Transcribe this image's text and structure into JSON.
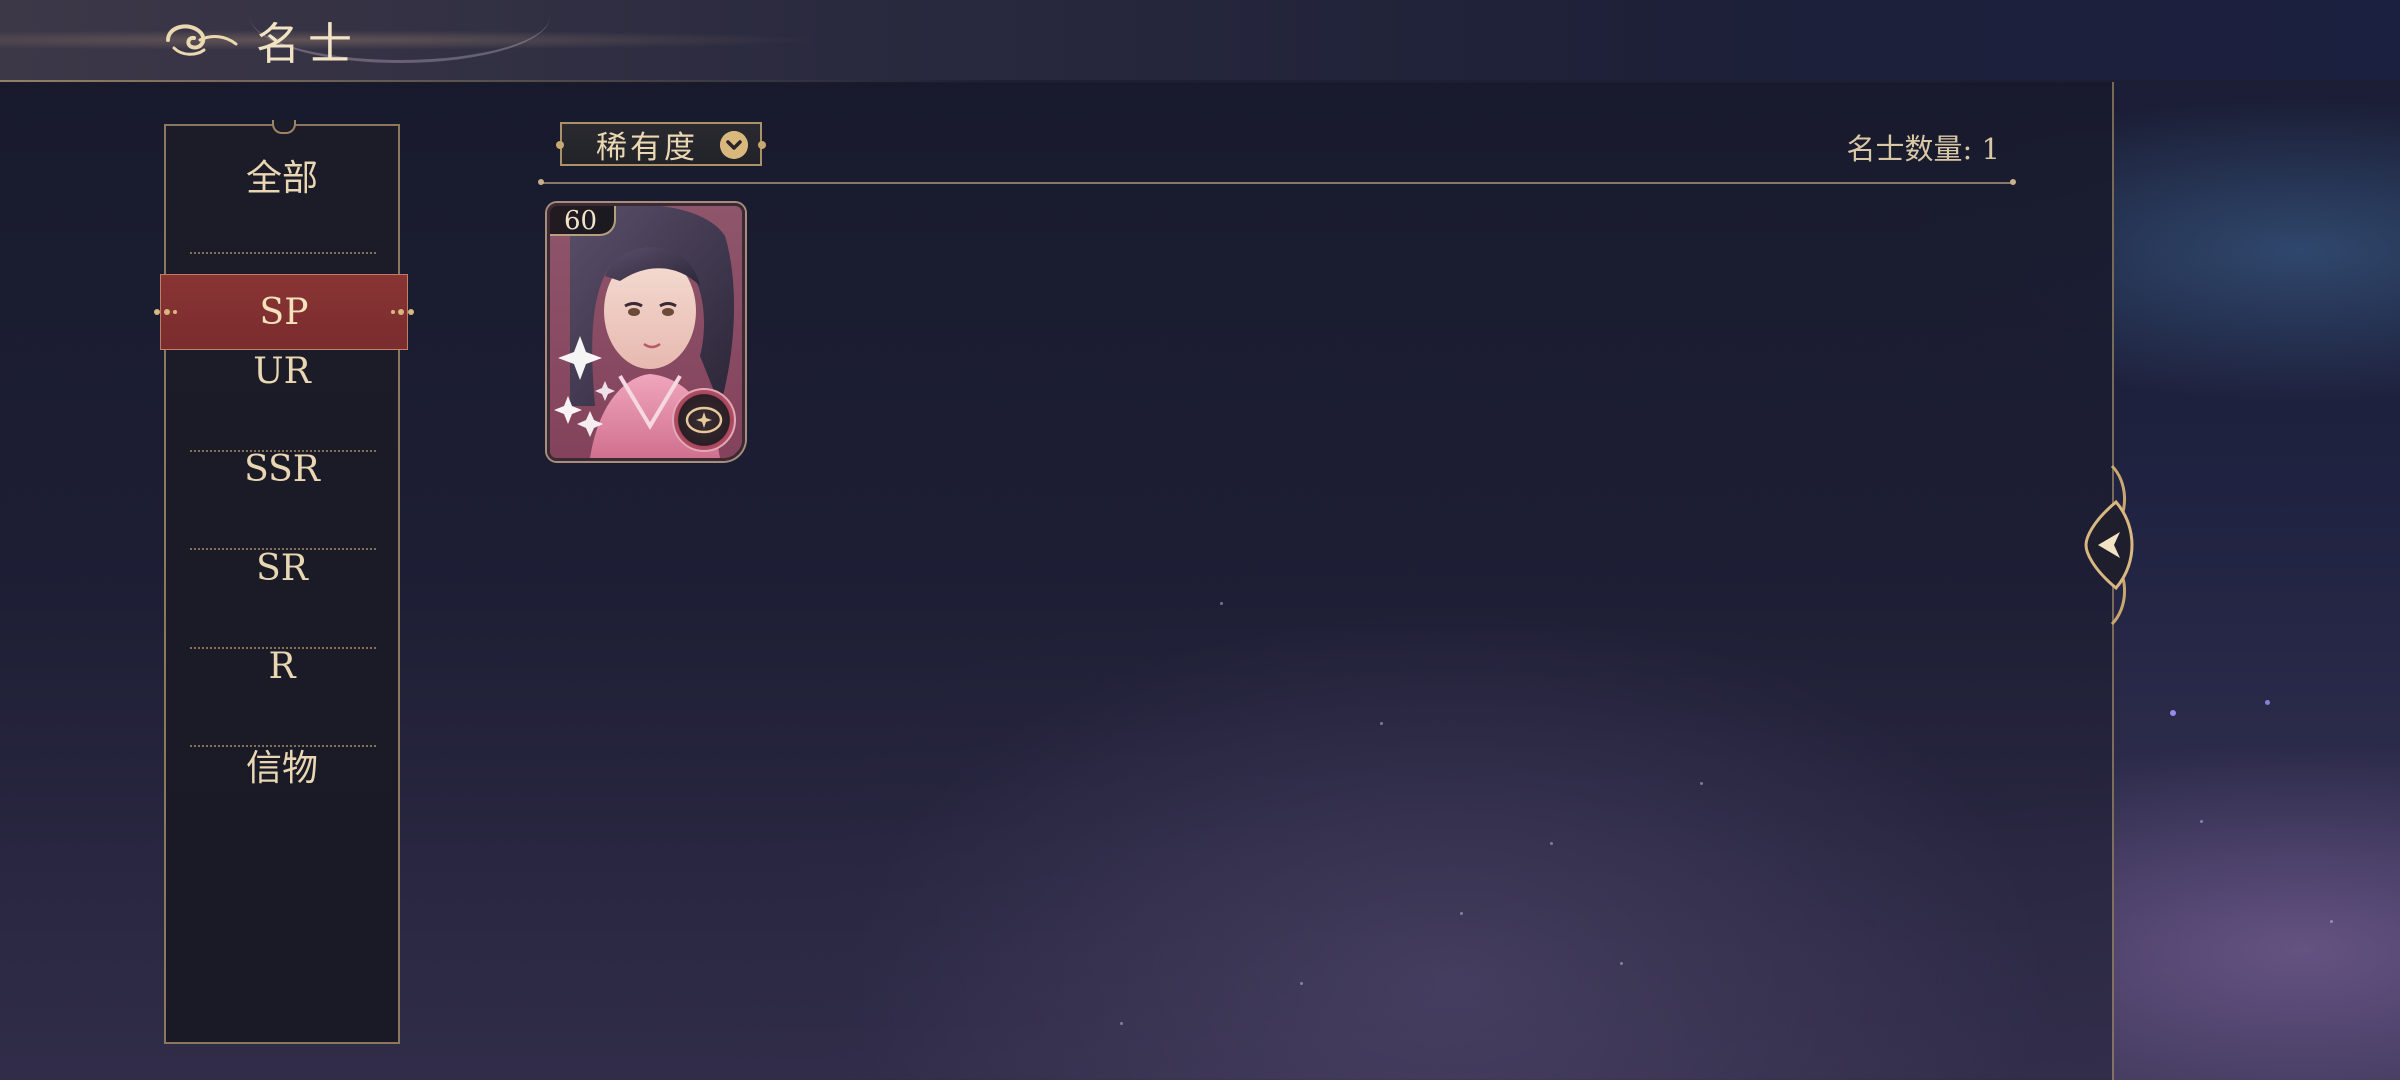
{
  "header": {
    "title": "名士",
    "back_icon": "swirl-back-icon"
  },
  "sidebar": {
    "items": [
      {
        "label": "全部",
        "active": false
      },
      {
        "label": "SP",
        "active": true
      },
      {
        "label": "UR",
        "active": false
      },
      {
        "label": "SSR",
        "active": false
      },
      {
        "label": "SR",
        "active": false
      },
      {
        "label": "R",
        "active": false
      },
      {
        "label": "信物",
        "active": false
      }
    ]
  },
  "toolbar": {
    "sort_dropdown": "稀有度",
    "sort_icon": "chevron-down-icon",
    "count_text": "名士数量: 1"
  },
  "cards": [
    {
      "level": "60",
      "emblem_icon": "compass-emblem-icon"
    }
  ],
  "panel": {
    "collapse_icon": "arrow-left-icon"
  },
  "colors": {
    "gold": "#c9a86f",
    "active_red": "#8a3434",
    "text_light": "#e8d7b2"
  }
}
